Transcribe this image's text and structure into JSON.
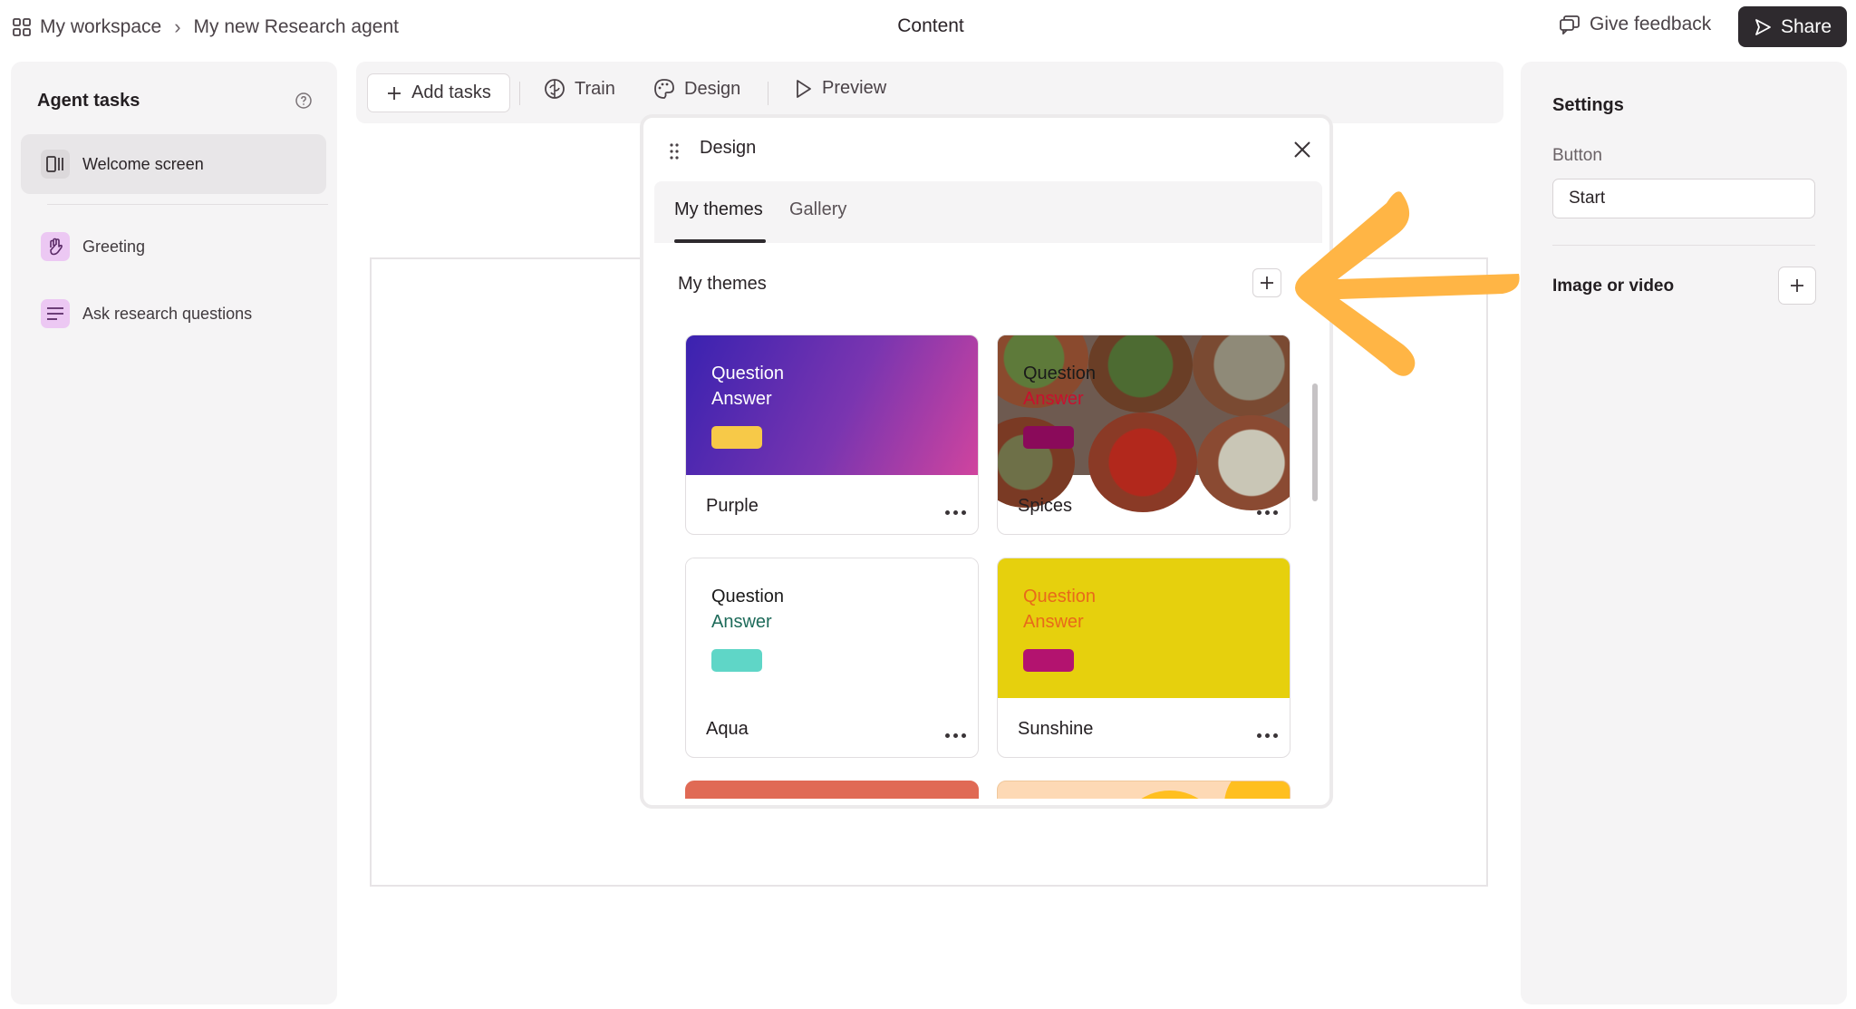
{
  "topbar": {
    "workspace": "My workspace",
    "agent_name": "My new Research agent",
    "center_title": "Content",
    "feedback_label": "Give feedback",
    "share_label": "Share"
  },
  "left_panel": {
    "heading": "Agent tasks",
    "tasks": [
      {
        "label": "Welcome screen",
        "icon": "welcome-screen-icon",
        "active": true
      },
      {
        "label": "Greeting",
        "icon": "waving-hand-icon",
        "color": "#e9c6f2"
      },
      {
        "label": "Ask research questions",
        "icon": "text-lines-icon",
        "color": "#e9c6f2"
      }
    ]
  },
  "toolbar": {
    "add_tasks": "Add tasks",
    "train": "Train",
    "design": "Design",
    "preview": "Preview"
  },
  "right_panel": {
    "heading": "Settings",
    "button_label": "Button",
    "button_value": "Start",
    "image_label": "Image or video"
  },
  "design_popup": {
    "title": "Design",
    "tabs": [
      "My themes",
      "Gallery"
    ],
    "active_tab": "My themes",
    "section_title": "My themes",
    "themes": [
      {
        "name": "Purple",
        "question": "Question",
        "answer": "Answer",
        "q_color": "#ffffff",
        "a_color": "#ffffff",
        "swatch": "#f7c948"
      },
      {
        "name": "Spices",
        "question": "Question",
        "answer": "Answer",
        "q_color": "#1a1a1a",
        "a_color": "#c8102e",
        "swatch": "#8a0a5a"
      },
      {
        "name": "Aqua",
        "question": "Question",
        "answer": "Answer",
        "q_color": "#1a1a1a",
        "a_color": "#1e6b5a",
        "swatch": "#5fd6c7"
      },
      {
        "name": "Sunshine",
        "question": "Question",
        "answer": "Answer",
        "q_color": "#e86a1a",
        "a_color": "#e86a1a",
        "swatch": "#b3136f"
      }
    ]
  },
  "colors": {
    "accent_dark": "#2e2a2e",
    "arrow": "#ffb545",
    "sunshine_bg": "#e6d00d"
  }
}
